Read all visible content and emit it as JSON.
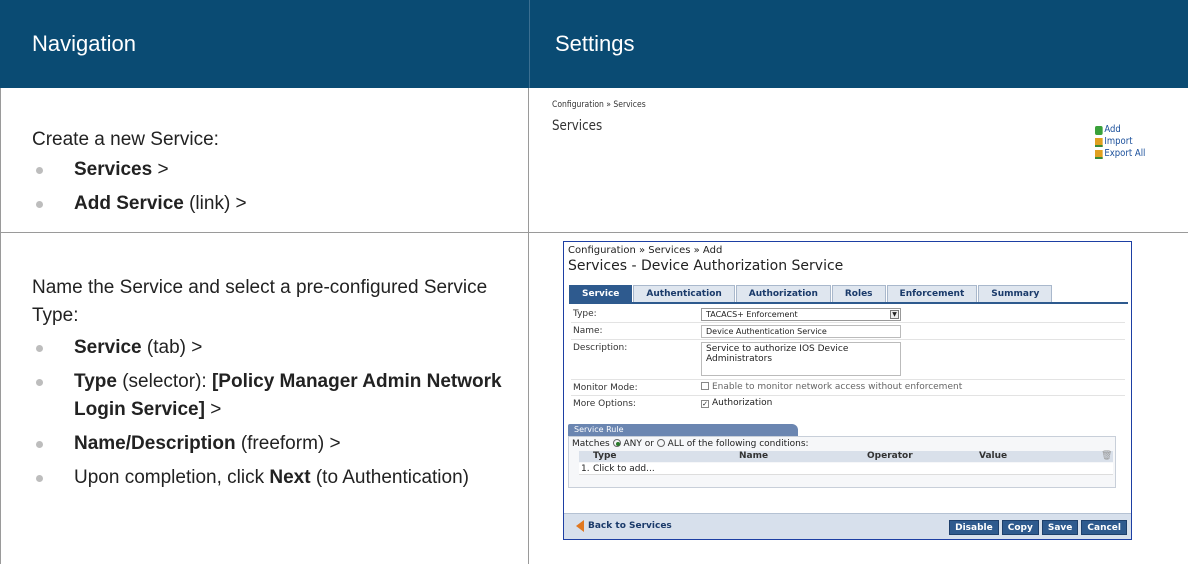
{
  "header": {
    "navigation": "Navigation",
    "settings": "Settings"
  },
  "row1": {
    "intro": "Create a new Service:",
    "steps": [
      {
        "bold": "Services",
        "rest": " >"
      },
      {
        "bold": "Add Service",
        "rest": " (link) >"
      }
    ],
    "screen": {
      "breadcrumb": "Configuration » Services",
      "title": "Services",
      "actions": {
        "add": "Add",
        "import": "Import",
        "export": "Export All"
      }
    }
  },
  "row2": {
    "intro": "Name the Service and select a pre-configured Service Type:",
    "steps": [
      {
        "pre": "",
        "bold": "Service",
        "rest": " (tab) >"
      },
      {
        "pre": "",
        "bold": "Type",
        "rest": " (selector): ",
        "bold2": "[Policy Manager Admin Network Login Service]",
        "rest2": " >"
      },
      {
        "pre": "",
        "bold": "Name/Description",
        "rest": " (freeform) >"
      },
      {
        "pre": "Upon completion, click ",
        "bold": "Next",
        "rest": " (to Authentication)"
      }
    ],
    "screen": {
      "breadcrumb": "Configuration » Services » Add",
      "title": "Services - Device Authorization Service",
      "tabs": [
        "Service",
        "Authentication",
        "Authorization",
        "Roles",
        "Enforcement",
        "Summary"
      ],
      "form": {
        "type_label": "Type:",
        "type_value": "TACACS+ Enforcement",
        "name_label": "Name:",
        "name_value": "Device Authentication Service",
        "desc_label": "Description:",
        "desc_value": "Service to authorize IOS Device Administrators",
        "monitor_label": "Monitor Mode:",
        "monitor_text": "Enable to monitor network access without enforcement",
        "options_label": "More Options:",
        "options_text": "Authorization"
      },
      "rule": {
        "tab": "Service Rule",
        "matches": "Matches",
        "any": "ANY",
        "or": "or",
        "all": "ALL",
        "of": "of the following conditions:",
        "columns": [
          "Type",
          "Name",
          "Operator",
          "Value"
        ],
        "row_num": "1.",
        "row_text": "Click to add..."
      },
      "footer": {
        "back": "Back to Services",
        "buttons": [
          "Disable",
          "Copy",
          "Save",
          "Cancel"
        ]
      }
    }
  }
}
